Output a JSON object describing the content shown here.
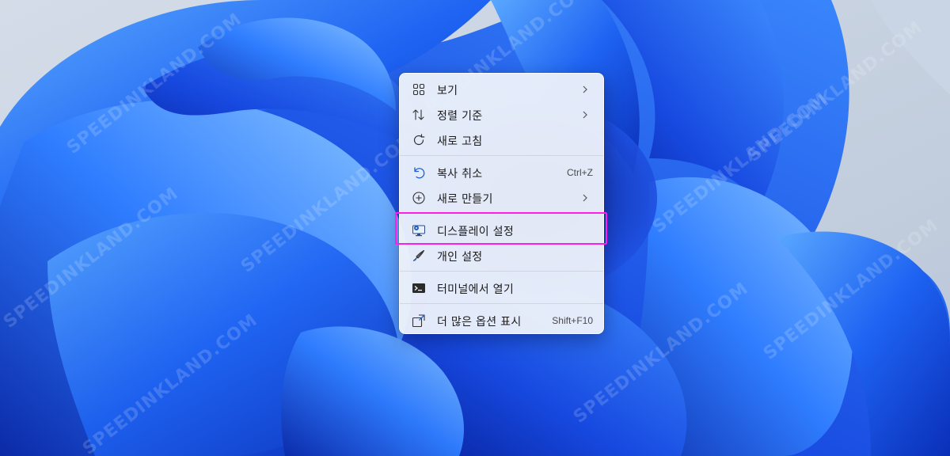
{
  "wallpaper": {
    "colors": {
      "deep": "#0a2fc4",
      "mid": "#1a5cf0",
      "light": "#4aa0ff",
      "sky": "#c7d2e0"
    },
    "watermark_text": "SPEEDINKLAND.COM"
  },
  "context_menu": {
    "items": [
      {
        "id": "view",
        "label": "보기",
        "icon": "grid-icon",
        "submenu": true
      },
      {
        "id": "sort",
        "label": "정렬 기준",
        "icon": "sort-icon",
        "submenu": true
      },
      {
        "id": "refresh",
        "label": "새로 고침",
        "icon": "refresh-icon"
      },
      {
        "id": "undo",
        "label": "복사 취소",
        "icon": "undo-icon",
        "shortcut": "Ctrl+Z"
      },
      {
        "id": "new",
        "label": "새로 만들기",
        "icon": "plus-circle-icon",
        "submenu": true
      },
      {
        "id": "display",
        "label": "디스플레이 설정",
        "icon": "display-settings-icon",
        "highlighted": true
      },
      {
        "id": "personalize",
        "label": "개인 설정",
        "icon": "brush-icon"
      },
      {
        "id": "terminal",
        "label": "터미널에서 열기",
        "icon": "terminal-icon"
      },
      {
        "id": "more",
        "label": "더 많은 옵션 표시",
        "icon": "more-options-icon",
        "shortcut": "Shift+F10"
      }
    ],
    "highlight_color": "#ff1ee6"
  }
}
